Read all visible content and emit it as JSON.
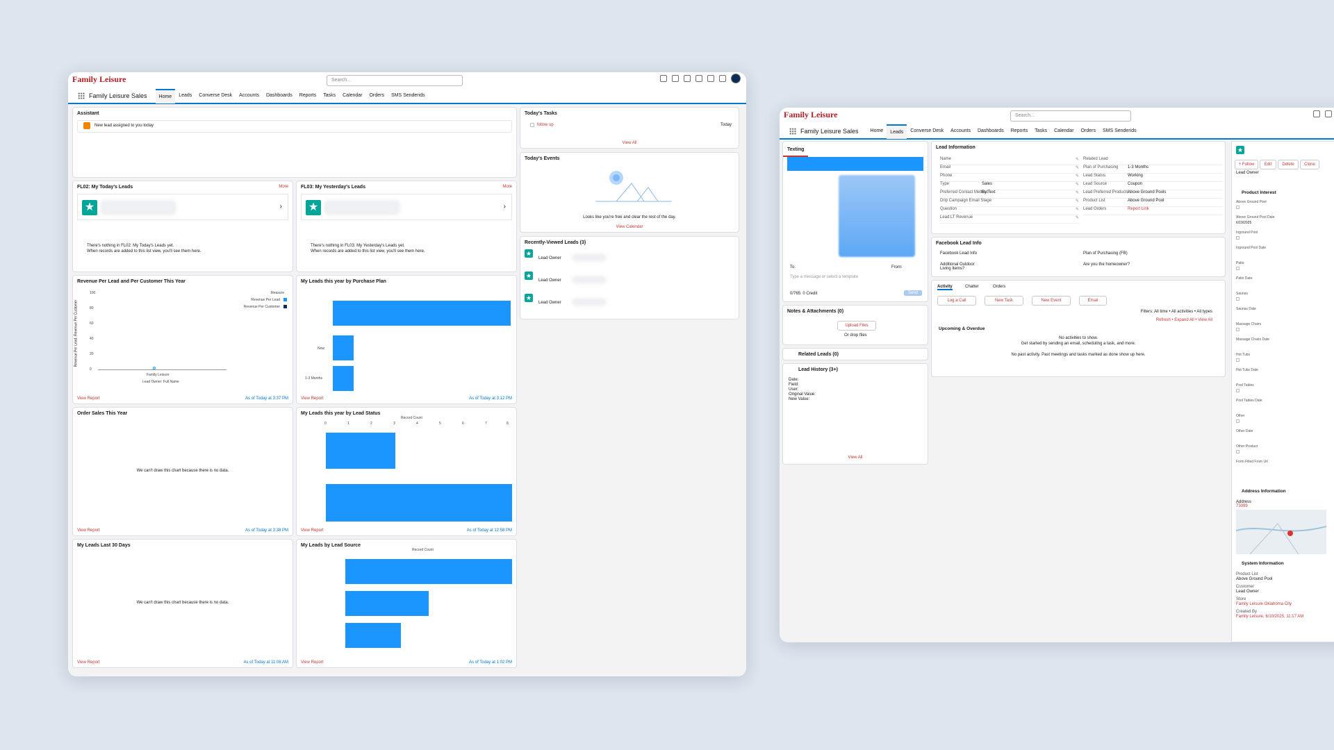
{
  "left": {
    "logo": "Family Leisure",
    "search": "Search...",
    "app": "Family Leisure Sales",
    "nav": [
      "Home",
      "Leads",
      "Converse Desk",
      "Accounts",
      "Dashboards",
      "Reports",
      "Tasks",
      "Calendar",
      "Orders",
      "SMS Senderids"
    ],
    "assistant": {
      "title": "Assistant",
      "item": "New lead assigned to you today"
    },
    "tasks": {
      "title": "Today's Tasks",
      "item": "follow up",
      "today": "Today",
      "view_all": "View All"
    },
    "events": {
      "title": "Today's Events",
      "empty": "Looks like you're free and clear the rest of the day.",
      "link": "View Calendar"
    },
    "recent": {
      "title": "Recently-Viewed Leads (3)",
      "label": "Lead Owner"
    },
    "fl02": {
      "title": "FL02: My Today's Leads",
      "more": "More",
      "empty1": "There's nothing in FL02: My Today's Leads yet.",
      "empty2": "When records are added to this list view, you'll see them here."
    },
    "fl03": {
      "title": "FL03: My Yesterday's Leads",
      "more": "More",
      "empty1": "There's nothing in FL03: My Yesterday's Leads yet.",
      "empty2": "When records are added to this list view, you'll see them here."
    },
    "rev": {
      "title": "Revenue Per Lead and Per Customer This Year",
      "view": "View Report",
      "asof": "As of Today at 3:37 PM",
      "ylabel": "Revenue Per Lead, Revenue Per Customer",
      "xlabel": "Lead Owner: Full Name",
      "legend_title": "Measure",
      "legend": [
        "Revenue Per Lead",
        "Revenue Per Customer"
      ],
      "yticks": [
        "100",
        "80",
        "60",
        "40",
        "20",
        "0"
      ],
      "cat": "Family Leisure"
    },
    "purchase": {
      "title": "My Leads this year by Purchase Plan",
      "view": "View Report",
      "asof": "As of Today at 3:12 PM",
      "labels": [
        "",
        "Now",
        "1-3 Months"
      ]
    },
    "orders": {
      "title": "Order Sales This Year",
      "nodata": "We can't draw this chart because there is no data.",
      "view": "View Report",
      "asof": "As of Today at 3:38 PM"
    },
    "status": {
      "title": "My Leads this year by Lead Status",
      "axis": "Record Count",
      "ticks": [
        "0",
        "1",
        "2",
        "3",
        "4",
        "5",
        "6",
        "7",
        "8"
      ],
      "view": "View Report",
      "asof": "As of Today at 12:58 PM"
    },
    "last30": {
      "title": "My Leads Last 30 Days",
      "nodata": "We can't draw this chart because there is no data.",
      "view": "View Report",
      "asof": "As of Today at 11:08 AM"
    },
    "source": {
      "title": "My Leads by Lead Source",
      "axis": "Record Count",
      "view": "View Report",
      "asof": "As of Today at 1:02 PM"
    }
  },
  "right": {
    "logo": "Family Leisure",
    "search": "Search...",
    "app": "Family Leisure Sales",
    "nav": [
      "Home",
      "Leads",
      "Converse Desk",
      "Accounts",
      "Dashboards",
      "Reports",
      "Tasks",
      "Calendar",
      "Orders",
      "SMS Senderids"
    ],
    "texting": {
      "tab": "Texting",
      "to": "To:",
      "from": "From:",
      "placeholder": "Type a message or select a template",
      "count": "0/765: 0 Credit",
      "send": "Send"
    },
    "notes": {
      "title": "Notes & Attachments (0)",
      "upload": "Upload Files",
      "drop": "Or drop files"
    },
    "related": {
      "title": "Related Leads (0)"
    },
    "history": {
      "title": "Lead History (3+)",
      "fields": [
        "Date:",
        "Field:",
        "User:",
        "Original Value:",
        "New Value:"
      ],
      "view_all": "View All"
    },
    "leadinfo": {
      "title": "Lead Information",
      "left": [
        "Name",
        "Email",
        "Phone",
        "Type",
        "Preferred Contact Method",
        "Drip Campaign Email Stage",
        "Question",
        "Lead LT Revenue"
      ],
      "left_vals": [
        "",
        "",
        "",
        "Sales",
        "By Text",
        "",
        "",
        ""
      ],
      "right": [
        "Related Lead",
        "Plan of Purchasing",
        "Lead Status",
        "Lead Source",
        "Lead Preferred Products",
        "Product List",
        "Lead Orders"
      ],
      "right_vals": [
        "",
        "1-3 Months",
        "Working",
        "Coupon",
        "Above Ground Pools",
        "Above Ground Pool",
        "Report Link"
      ]
    },
    "fbinfo": {
      "title": "Facebook Lead Info",
      "l1": "Facebook Lead Info",
      "l2": "Additional Outdoor Living Items?",
      "r1": "Plan of Purchasing (FB)",
      "r2": "Are you the homeowner?"
    },
    "activity": {
      "tabs": [
        "Activity",
        "Chatter",
        "Orders"
      ],
      "buttons": [
        "Log a Call",
        "New Task",
        "New Event",
        "Email"
      ],
      "filters": "Filters: All time • All activities • All types",
      "links": "Refresh • Expand All • View All",
      "upcoming": "Upcoming & Overdue",
      "none": "No activities to show.",
      "hint": "Get started by sending an email, scheduling a task, and more.",
      "past": "No past activity. Past meetings and tasks marked as done show up here."
    },
    "side": {
      "actions": [
        "+ Follow",
        "Edit",
        "Delete",
        "Clone"
      ],
      "owner": "Lead Owner",
      "product": "Product Interest",
      "fields": [
        "Above Ground Pool",
        "Above Ground Pool Date",
        "Inground Pool",
        "Inground Pool Date",
        "Patio",
        "Patio Date",
        "Saunas",
        "Saunas Date",
        "Massage Chairs",
        "Massage Chairs Date",
        "Hot Tubs",
        "Hot Tubs Date",
        "Pool Tables",
        "Pool Tables Date",
        "Other",
        "Other Date",
        "Other Product",
        "Form Filled From Url"
      ],
      "date_val": "6/19/2025",
      "address": "Address Information",
      "addr_label": "Address",
      "addr_val": "73099",
      "system": "System Information",
      "sys": [
        "Product List",
        "Above Ground Pool",
        "Customer",
        "Lead Owner",
        "Store",
        "Family Leisure Oklahoma City",
        "Created By",
        "Family Leisure, 6/10/2025, 11:17 AM"
      ]
    }
  },
  "colors": {
    "accent": "#0176d3",
    "bar": "#1b96ff",
    "red": "#c23934",
    "teal": "#06a59a"
  }
}
